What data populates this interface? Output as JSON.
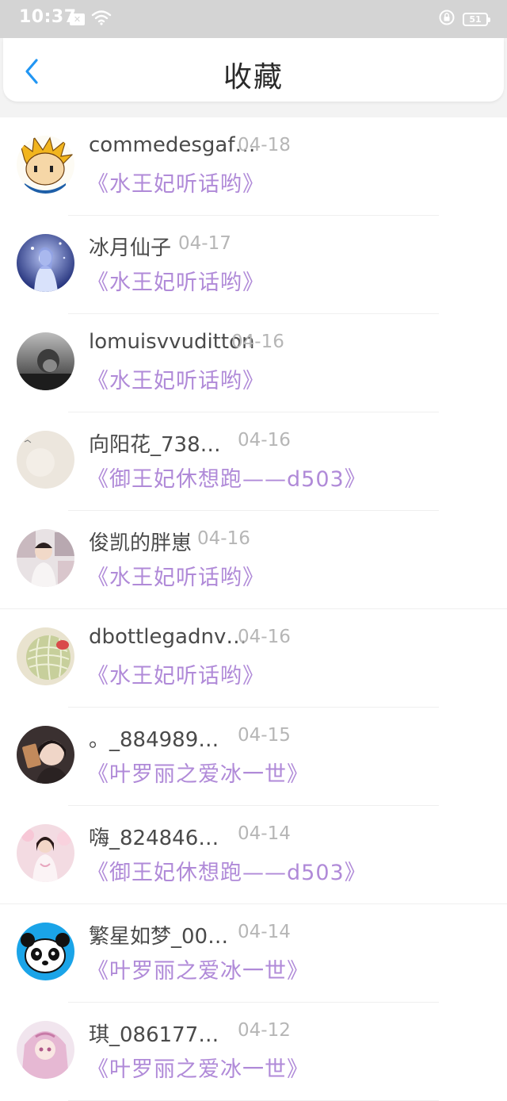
{
  "status_bar": {
    "time": "10:37",
    "battery": "51"
  },
  "header": {
    "title": "收藏"
  },
  "favorites": [
    {
      "name": "commedesgaf…",
      "date": "04-18",
      "book": "《水王妃听话哟》"
    },
    {
      "name": "冰月仙子",
      "date": "04-17",
      "book": "《水王妃听话哟》"
    },
    {
      "name": "lomuisvvuditton",
      "date": "04-16",
      "book": "《水王妃听话哟》"
    },
    {
      "name": "向阳花_738…",
      "date": "04-16",
      "book": "《御王妃休想跑——d503》"
    },
    {
      "name": "俊凯的胖崽",
      "date": "04-16",
      "book": "《水王妃听话哟》"
    },
    {
      "name": "dbottlegadnv…",
      "date": "04-16",
      "book": "《水王妃听话哟》"
    },
    {
      "name": "。_884989…",
      "date": "04-15",
      "book": "《叶罗丽之爱冰一世》"
    },
    {
      "name": "嗨_824846…",
      "date": "04-14",
      "book": "《御王妃休想跑——d503》"
    },
    {
      "name": "繁星如梦_00…",
      "date": "04-14",
      "book": "《叶罗丽之爱冰一世》"
    },
    {
      "name": "琪_086177…",
      "date": "04-12",
      "book": "《叶罗丽之爱冰一世》"
    }
  ],
  "colors": {
    "accent": "#2196f3",
    "book_title": "#b08ad8",
    "status_bar": "#d4d4d4"
  },
  "icons": {
    "back": "chevron-left-icon",
    "wifi": "wifi-icon",
    "lock": "lock-rotation-icon",
    "battery": "battery-icon"
  }
}
